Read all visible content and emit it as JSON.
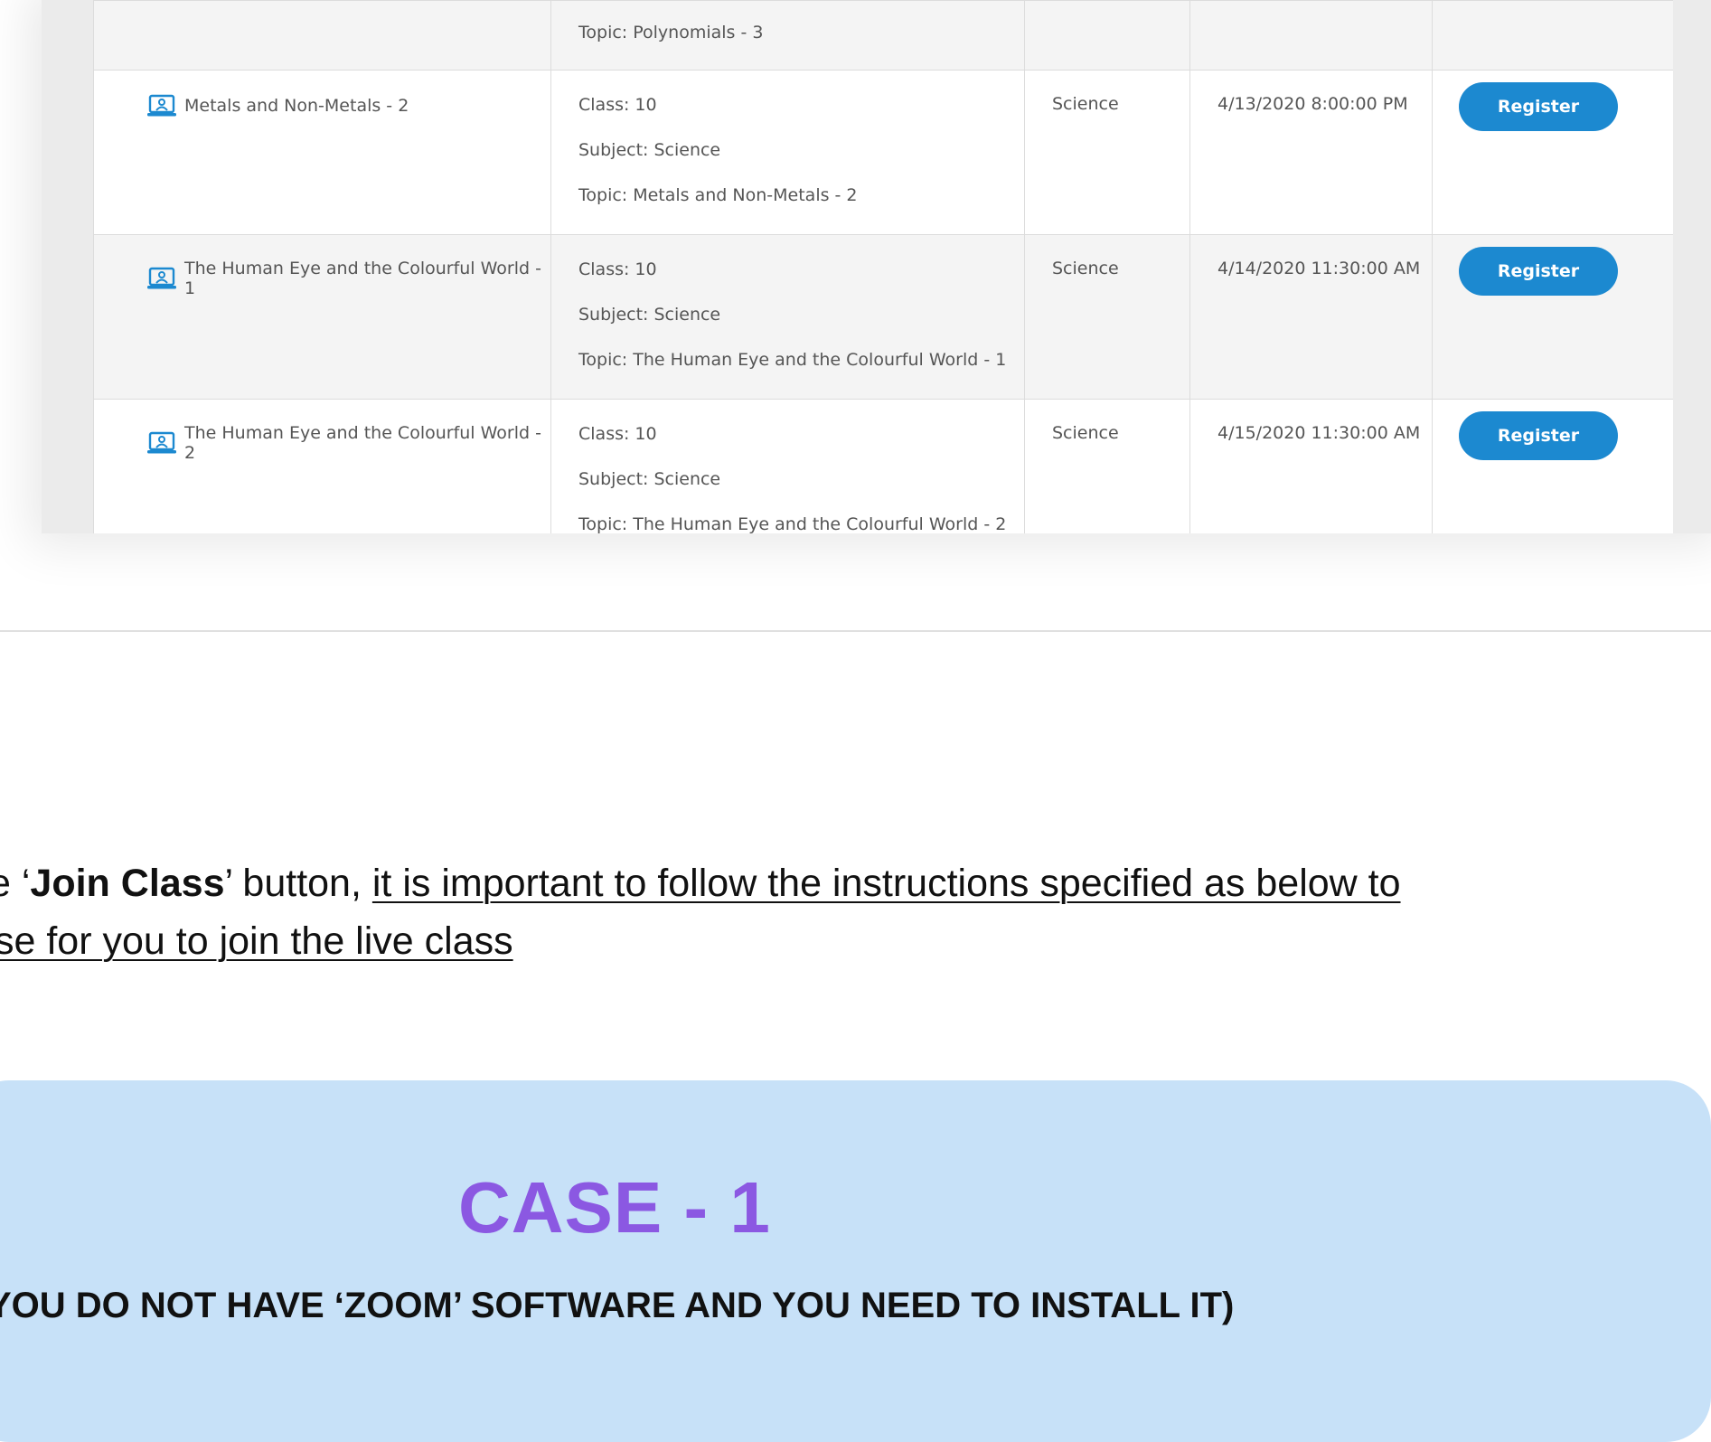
{
  "table": {
    "rows": [
      {
        "title": "",
        "details": [
          "Topic: Polynomials - 3"
        ],
        "subject": "",
        "datetime": "",
        "button": ""
      },
      {
        "title": "Metals and Non-Metals - 2",
        "details": [
          "Class: 10",
          "Subject: Science",
          "Topic: Metals and Non-Metals - 2"
        ],
        "subject": "Science",
        "datetime": "4/13/2020 8:00:00 PM",
        "button": "Register"
      },
      {
        "title": "The Human Eye and the Colourful World - 1",
        "details": [
          "Class: 10",
          "Subject: Science",
          "Topic: The Human Eye and the Colourful World - 1"
        ],
        "subject": "Science",
        "datetime": "4/14/2020 11:30:00 AM",
        "button": "Register"
      },
      {
        "title": "The Human Eye and the Colourful World - 2",
        "details": [
          "Class: 10",
          "Subject: Science",
          "Topic: The Human Eye and the Colourful World - 2"
        ],
        "subject": "Science",
        "datetime": "4/15/2020 11:30:00 AM",
        "button": "Register"
      }
    ]
  },
  "instruction": {
    "line1_prefix": "e ‘",
    "line1_bold": "Join Class",
    "line1_mid": "’ button, ",
    "line1_underlined": "it is important to follow the instructions specified as below to",
    "line2_underlined": "se for you to join the live class"
  },
  "case": {
    "title": "CASE - 1",
    "subtitle": "YOU DO NOT HAVE ‘ZOOM’ SOFTWARE AND YOU NEED TO INSTALL IT)"
  },
  "colors": {
    "button": "#1c89d0",
    "panel": "#c7e1f8",
    "case_title": "#8b58e2"
  },
  "icons": {
    "course": "online-class-icon"
  }
}
